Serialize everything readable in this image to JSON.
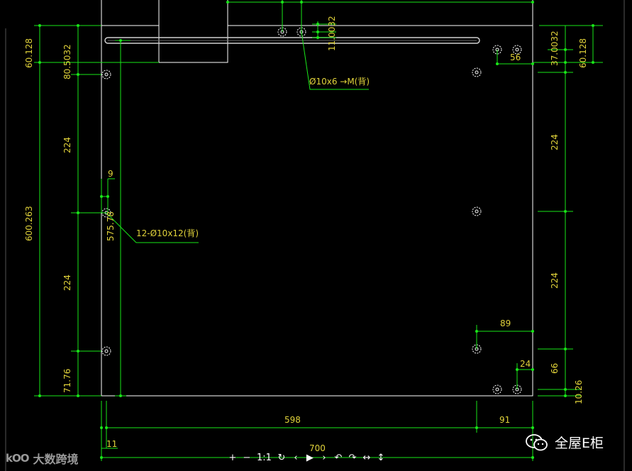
{
  "colors": {
    "background": "#000000",
    "outline": "#ffffff",
    "dimension_line": "#19e619",
    "dimension_text": "#e0d23a",
    "slot": "#cfcfcf"
  },
  "dimensions": {
    "left_outer": "600.263",
    "left_top": "60.128",
    "left_upper": "80.5032",
    "left_224_upper": "224",
    "left_224_lower": "224",
    "left_bottom": "71.76",
    "inner_height": "575.78",
    "inner_offset": "9",
    "top_small": "11.0032",
    "right_top_a": "37.0032",
    "right_top_b": "60.128",
    "right_56": "56",
    "right_224_upper": "224",
    "right_224_lower": "224",
    "right_66": "66",
    "right_10_26": "10.26",
    "right_89": "89",
    "right_24": "24",
    "bottom_598": "598",
    "bottom_91": "91",
    "bottom_11": "11",
    "bottom_700": "700"
  },
  "notes": {
    "hole_top": "Ø10x6 →M(背)",
    "hole_side": "12-Ø10x12(背)"
  },
  "toolbar": {
    "buttons": [
      {
        "label": "+",
        "icon": "zoom-in-icon"
      },
      {
        "label": "−",
        "icon": "zoom-out-icon"
      },
      {
        "label": "1:1",
        "icon": "actual-size-icon"
      },
      {
        "label": "↻",
        "icon": "reset-icon"
      },
      {
        "label": "‹",
        "icon": "previous-icon"
      },
      {
        "label": "▶",
        "icon": "play-icon"
      },
      {
        "label": "›",
        "icon": "next-icon"
      },
      {
        "label": "↶",
        "icon": "rotate-left-icon"
      },
      {
        "label": "↷",
        "icon": "rotate-right-icon"
      },
      {
        "label": "↔",
        "icon": "flip-horizontal-icon"
      },
      {
        "label": "↕",
        "icon": "flip-vertical-icon"
      }
    ]
  },
  "branding": {
    "left_mark": "kOO",
    "left_text": "大数跨境",
    "right_text": "全屋E柜"
  }
}
